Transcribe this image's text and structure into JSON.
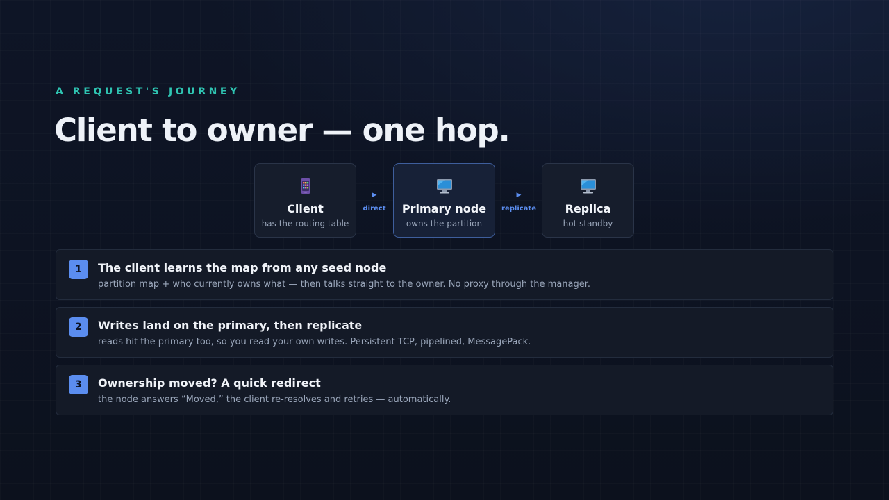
{
  "header": {
    "eyebrow": "A REQUEST'S JOURNEY",
    "title": "Client to owner — one hop."
  },
  "flow": {
    "nodes": [
      {
        "name": "Client",
        "subtitle": "has the routing table",
        "icon": "phone-icon"
      },
      {
        "name": "Primary node",
        "subtitle": "owns the partition",
        "icon": "monitor-icon"
      },
      {
        "name": "Replica",
        "subtitle": "hot standby",
        "icon": "monitor-icon"
      }
    ],
    "links": [
      {
        "arrow": "▶",
        "label": "direct"
      },
      {
        "arrow": "▶",
        "label": "replicate"
      }
    ]
  },
  "steps": [
    {
      "number": "1",
      "title": "The client learns the map from any seed node",
      "description": "partition map + who currently owns what — then talks straight to the owner. No proxy through the manager."
    },
    {
      "number": "2",
      "title": "Writes land on the primary, then replicate",
      "description": "reads hit the primary too, so you read your own writes. Persistent TCP, pipelined, MessagePack."
    },
    {
      "number": "3",
      "title": "Ownership moved? A quick redirect",
      "description": "the node answers “Moved,” the client re-resolves and retries — automatically."
    }
  ],
  "colors": {
    "accent_teal": "#2fc4b2",
    "accent_blue": "#5b8def",
    "background": "#0e1526"
  }
}
